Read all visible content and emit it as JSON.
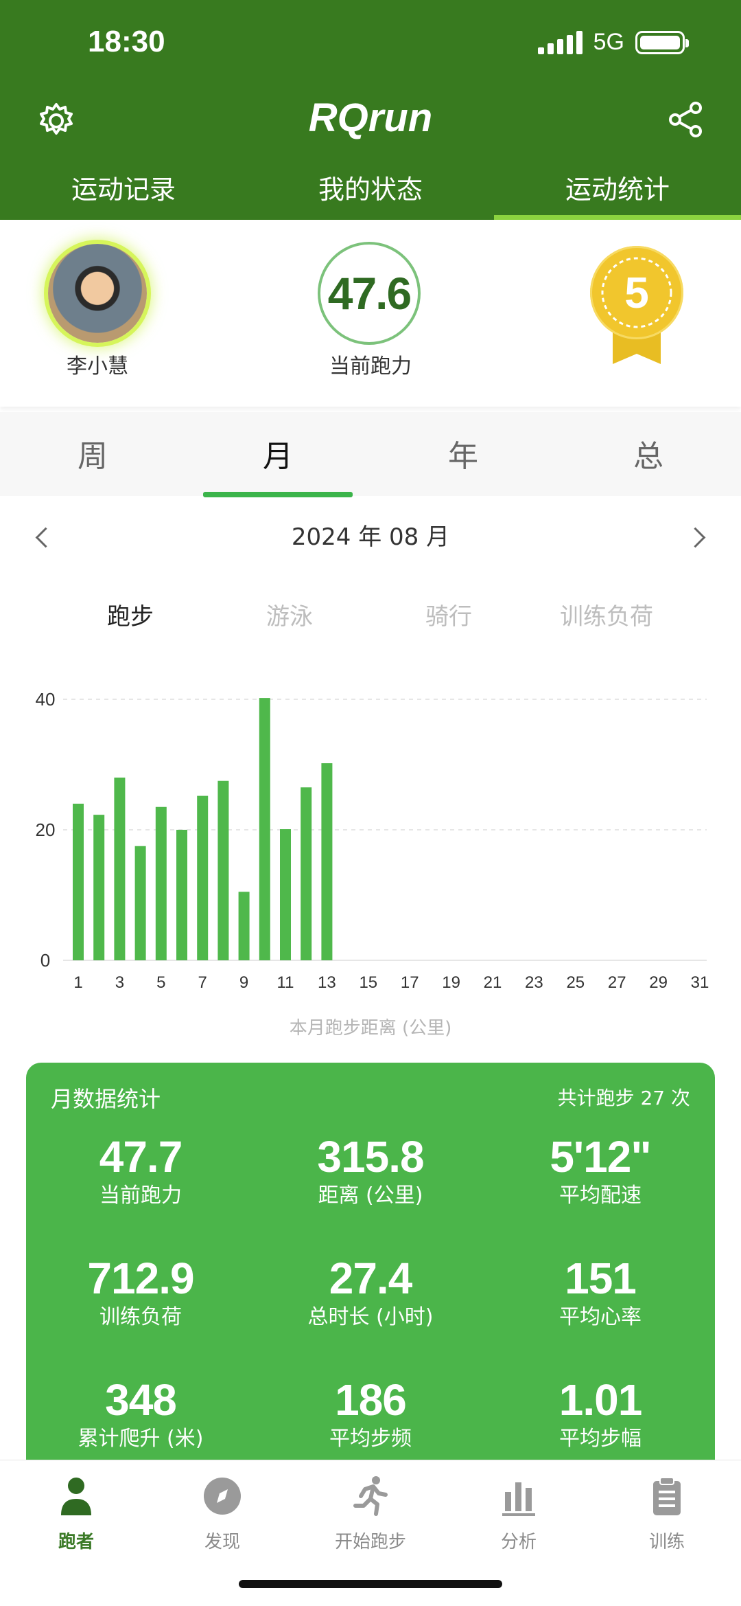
{
  "status": {
    "time": "18:30",
    "network": "5G"
  },
  "app": {
    "title": "RQrun"
  },
  "top_tabs": [
    {
      "label": "运动记录"
    },
    {
      "label": "我的状态"
    },
    {
      "label": "运动统计"
    }
  ],
  "profile": {
    "name": "李小慧",
    "run_power_value": "47.6",
    "run_power_label": "当前跑力",
    "badge_number": "5"
  },
  "period_tabs": [
    {
      "label": "周"
    },
    {
      "label": "月"
    },
    {
      "label": "年"
    },
    {
      "label": "总"
    }
  ],
  "period": {
    "current": "2024 年 08 月"
  },
  "sport_tabs": [
    {
      "label": "跑步"
    },
    {
      "label": "游泳"
    },
    {
      "label": "骑行"
    },
    {
      "label": "训练负荷"
    }
  ],
  "chart_data": {
    "type": "bar",
    "caption": "本月跑步距离 (公里)",
    "x": [
      1,
      2,
      3,
      4,
      5,
      6,
      7,
      8,
      9,
      10,
      11,
      12,
      13
    ],
    "values": [
      24,
      22.3,
      28,
      17.5,
      23.5,
      20,
      25.2,
      27.5,
      10.5,
      40.2,
      20.1,
      26.5,
      30.2
    ],
    "x_ticks": [
      "1",
      "3",
      "5",
      "7",
      "9",
      "11",
      "13",
      "15",
      "17",
      "19",
      "21",
      "23",
      "25",
      "27",
      "29",
      "31"
    ],
    "y_ticks": [
      "0",
      "20",
      "40"
    ],
    "xlim": [
      1,
      31
    ],
    "ylim": [
      0,
      40
    ],
    "grid": true,
    "bar_color": "#4fb84b"
  },
  "stats": {
    "title": "月数据统计",
    "total": "共计跑步 27 次",
    "items": [
      {
        "value": "47.7",
        "label": "当前跑力"
      },
      {
        "value": "315.8",
        "label": "距离 (公里)"
      },
      {
        "value": "5'12\"",
        "label": "平均配速"
      },
      {
        "value": "712.9",
        "label": "训练负荷"
      },
      {
        "value": "27.4",
        "label": "总时长 (小时)"
      },
      {
        "value": "151",
        "label": "平均心率"
      },
      {
        "value": "348",
        "label": "累计爬升 (米)"
      },
      {
        "value": "186",
        "label": "平均步频"
      },
      {
        "value": "1.01",
        "label": "平均步幅"
      }
    ]
  },
  "bottom_nav": [
    {
      "label": "跑者",
      "icon": "runner-person-icon"
    },
    {
      "label": "发现",
      "icon": "compass-icon"
    },
    {
      "label": "开始跑步",
      "icon": "running-figure-icon"
    },
    {
      "label": "分析",
      "icon": "bar-chart-icon"
    },
    {
      "label": "训练",
      "icon": "clipboard-icon"
    }
  ],
  "colors": {
    "header": "#387a1f",
    "accent": "#4bb54a",
    "tab_indicator": "#8bd33f"
  }
}
